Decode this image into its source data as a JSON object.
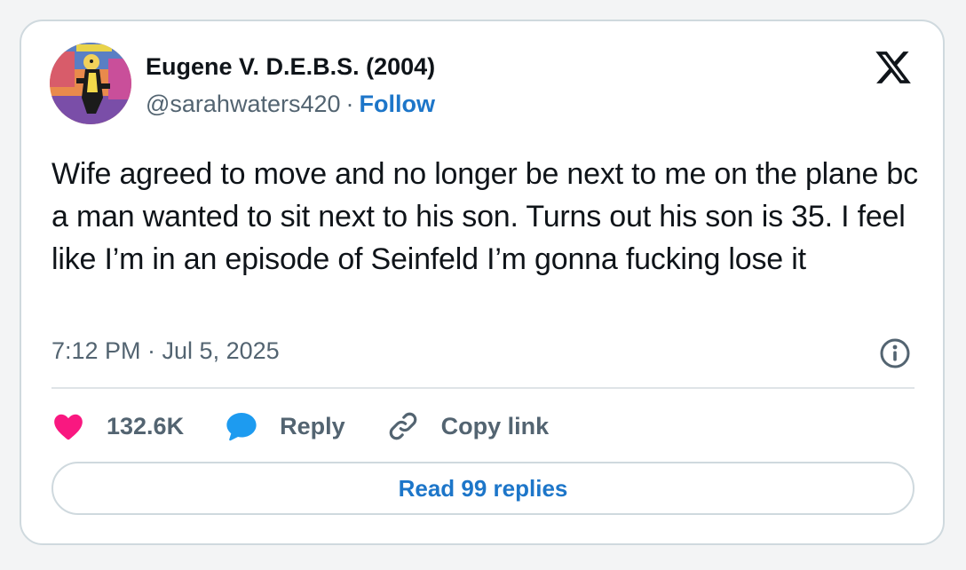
{
  "author": {
    "display_name": "Eugene V. D.E.B.S. (2004)",
    "handle": "@sarahwaters420",
    "separator": "·",
    "follow_label": "Follow",
    "avatar_icon": "cartoon-avatar-icon"
  },
  "brand": {
    "logo_icon": "x-logo-icon"
  },
  "tweet": {
    "text": "Wife agreed to move and no longer be next to me on the plane bc a man wanted to sit next to his son. Turns out his son is 35. I feel like I’m in an episode of Seinfeld I’m gonna fucking lose it",
    "timestamp": "7:12 PM · Jul 5, 2025",
    "info_icon": "info-icon"
  },
  "actions": {
    "like_count": "132.6K",
    "like_icon": "heart-icon",
    "reply_label": "Reply",
    "reply_icon": "speech-bubble-icon",
    "copy_link_label": "Copy link",
    "copy_link_icon": "link-icon"
  },
  "footer": {
    "read_replies_label": "Read 99 replies"
  },
  "colors": {
    "accent": "#1d76c9",
    "heart": "#f91880",
    "bubble": "#1d9bf0",
    "muted_text": "#536471",
    "border": "#cfd9de"
  }
}
